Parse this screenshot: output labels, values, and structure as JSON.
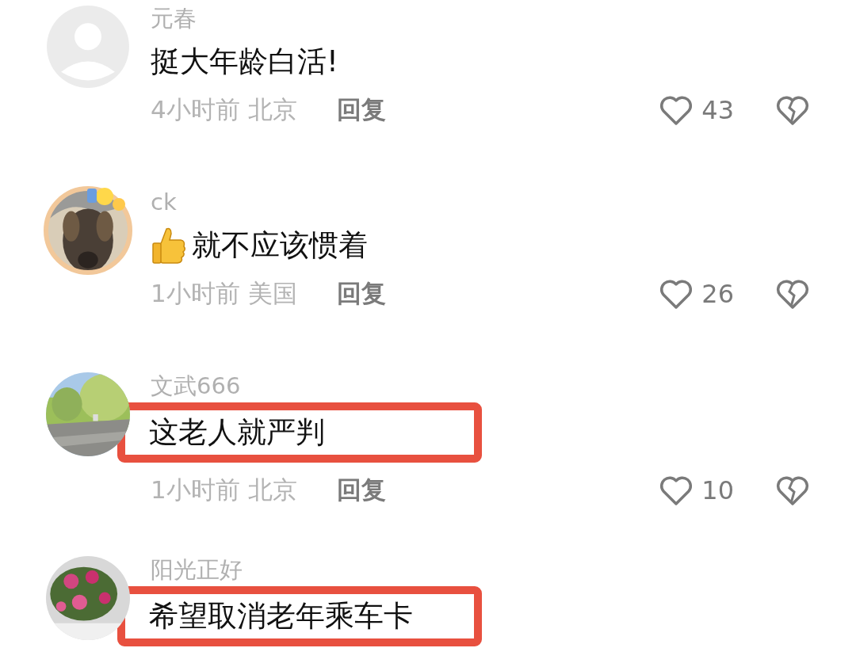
{
  "comments": [
    {
      "user": "元春",
      "avatar": {
        "kind": "default"
      },
      "avatar_frame": false,
      "emoji": false,
      "text": "挺大年龄白活!",
      "time": "4小时前",
      "location": "北京",
      "reply": "回复",
      "likes": "43",
      "highlighted": false
    },
    {
      "user": "ck",
      "avatar_frame": true,
      "emoji": true,
      "text": "就不应该惯着",
      "time": "1小时前",
      "location": "美国",
      "reply": "回复",
      "likes": "26",
      "highlighted": false
    },
    {
      "user": "文武666",
      "avatar_frame": false,
      "emoji": false,
      "text": "这老人就严判",
      "time": "1小时前",
      "location": "北京",
      "reply": "回复",
      "likes": "10",
      "highlighted": true
    },
    {
      "user": "阳光正好",
      "avatar_frame": false,
      "emoji": false,
      "text": "希望取消老年乘车卡",
      "highlighted": true
    }
  ]
}
